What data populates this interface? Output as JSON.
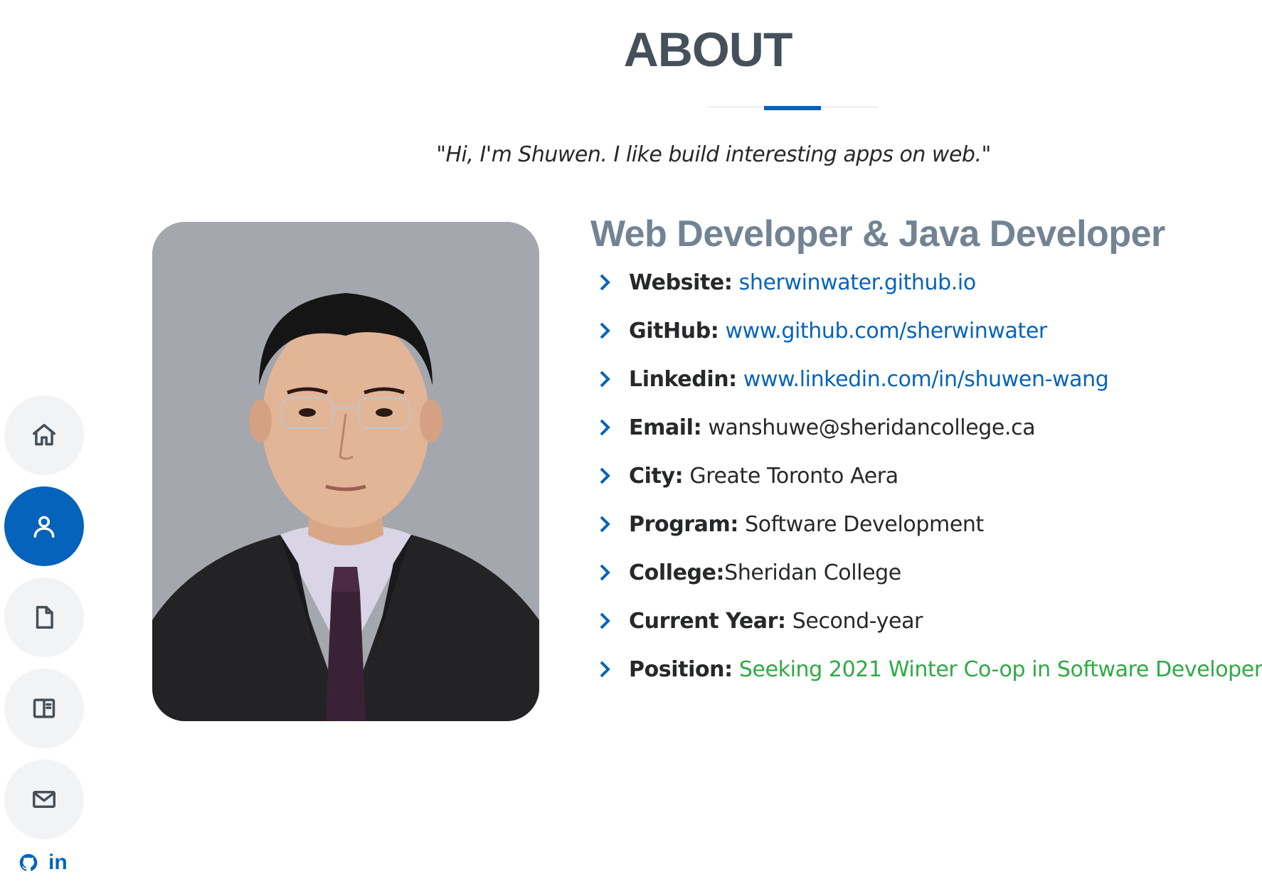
{
  "section": {
    "title": "ABOUT",
    "quote": "\"Hi, I'm Shuwen. I like build interesting apps on web.\""
  },
  "nav": {
    "items": [
      {
        "name": "home",
        "icon": "home-icon",
        "active": false
      },
      {
        "name": "about",
        "icon": "user-icon",
        "active": true
      },
      {
        "name": "resume",
        "icon": "file-icon",
        "active": false
      },
      {
        "name": "portfolio",
        "icon": "book-open-icon",
        "active": false
      },
      {
        "name": "contact",
        "icon": "envelope-icon",
        "active": false
      }
    ],
    "social": {
      "github_icon": "github-icon",
      "linkedin_text": "in"
    }
  },
  "profile": {
    "photo_icon": "profile-photo",
    "heading": "Web Developer & Java Developer",
    "details": [
      {
        "label": "Website:",
        "value": "sherwinwater.github.io",
        "style": "link"
      },
      {
        "label": "GitHub:",
        "value": "www.github.com/sherwinwater",
        "style": "link"
      },
      {
        "label": "Linkedin:",
        "value": "www.linkedin.com/in/shuwen-wang",
        "style": "link"
      },
      {
        "label": "Email:",
        "value": "wanshuwe@sheridancollege.ca",
        "style": "plain"
      },
      {
        "label": "City:",
        "value": "Greate Toronto Aera",
        "style": "plain"
      },
      {
        "label": "Program:",
        "value": "Software Development",
        "style": "plain"
      },
      {
        "label": "College:",
        "value": "Sheridan College",
        "style": "plain"
      },
      {
        "label": "Current Year:",
        "value": "Second-year",
        "style": "plain"
      },
      {
        "label": "Position:",
        "value": "Seeking 2021 Winter Co-op in Software Developer",
        "style": "green"
      }
    ]
  },
  "colors": {
    "accent": "#0563bb",
    "heading": "#45505b",
    "subheading": "#728394",
    "green": "#2eaa45",
    "nav_bg": "#f2f3f5"
  }
}
